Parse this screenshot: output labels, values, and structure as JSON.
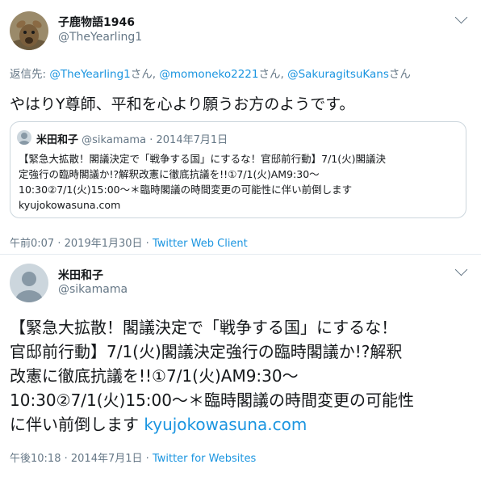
{
  "tweet1": {
    "name": "子鹿物語1946",
    "handle": "@TheYearling1",
    "reply_prefix": "返信先: ",
    "reply_to": [
      {
        "handle": "@TheYearling1",
        "suffix": "さん"
      },
      {
        "handle": "@momoneko2221",
        "suffix": "さん"
      },
      {
        "handle": "@SakuragitsuKans",
        "suffix": "さん"
      }
    ],
    "reply_sep": ", ",
    "text": "やはりY尊師、平和を心より願うお方のようです。",
    "quote": {
      "name": "米田和子",
      "handle": "@sikamama",
      "date": "2014年7月1日",
      "dot": "·",
      "text_lines": [
        "【緊急大拡散！閣議決定で「戦争する国」にするな！官邸前行動】7/1(火)閣議決",
        "定強行の臨時閣議か!?解釈改憲に徹底抗議を!!①7/1(火)AM9:30〜",
        "10:30②7/1(火)15:00〜＊臨時閣議の時間変更の可能性に伴い前倒します",
        "kyujokowasuna.com"
      ]
    },
    "time": "午前0:07",
    "date": "2019年1月30日",
    "dot": "·",
    "client": "Twitter Web Client"
  },
  "tweet2": {
    "name": "米田和子",
    "handle": "@sikamama",
    "text_lines": [
      "【緊急大拡散！閣議決定で「戦争する国」にするな！",
      "官邸前行動】7/1(火)閣議決定強行の臨時閣議か!?解釈",
      "改憲に徹底抗議を!!①7/1(火)AM9:30〜",
      "10:30②7/1(火)15:00〜＊臨時閣議の時間変更の可能性",
      "に伴い前倒します "
    ],
    "link": "kyujokowasuna.com",
    "time": "午後10:18",
    "date": "2014年7月1日",
    "dot": "·",
    "client": "Twitter for Websites"
  },
  "colors": {
    "link": "#1b95e0",
    "secondary": "#657786",
    "text": "#14171a",
    "border": "#ccd6dd"
  }
}
